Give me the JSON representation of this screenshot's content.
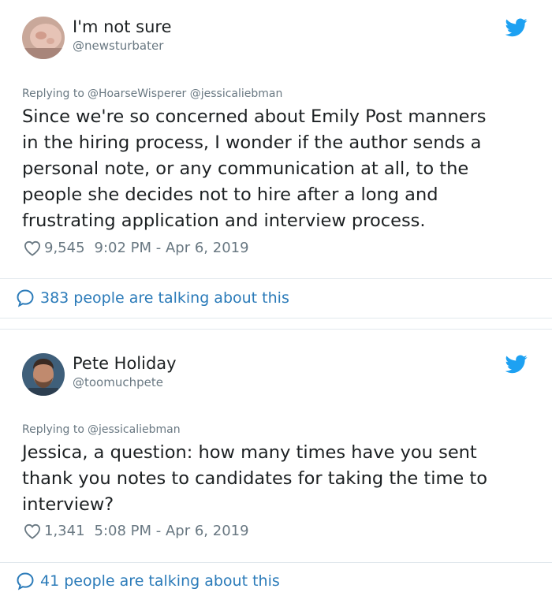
{
  "colors": {
    "text": "#1c2022",
    "muted": "#697882",
    "link": "#2b7bb9",
    "twitter_blue": "#1da1f2",
    "divider": "#e1e8ed"
  },
  "tweets": [
    {
      "display_name": "I'm not sure",
      "handle": "@newsturbater",
      "avatar_icon": "avatar-photo",
      "platform_icon": "twitter-bird-icon",
      "replying_prefix": "Replying to",
      "replying_to": "@HoarseWisperer @jessicaliebman",
      "text": "Since we're so concerned about Emily Post manners\nin the hiring process, I wonder if the author  sends a\npersonal note, or any communication at all, to the\npeople she decides not to hire after a long and\nfrustrating application and interview process.",
      "likes": "9,545",
      "timestamp": "9:02 PM - Apr 6, 2019",
      "talking": "383 people are talking about this"
    },
    {
      "display_name": "Pete Holiday",
      "handle": "@toomuchpete",
      "avatar_icon": "avatar-photo",
      "platform_icon": "twitter-bird-icon",
      "replying_prefix": "Replying to",
      "replying_to": "@jessicaliebman",
      "text": "Jessica, a question: how many times have you sent\nthank you notes to candidates for taking the time to\ninterview?",
      "likes": "1,341",
      "timestamp": "5:08 PM - Apr 6, 2019",
      "talking": "41 people are talking about this"
    }
  ]
}
